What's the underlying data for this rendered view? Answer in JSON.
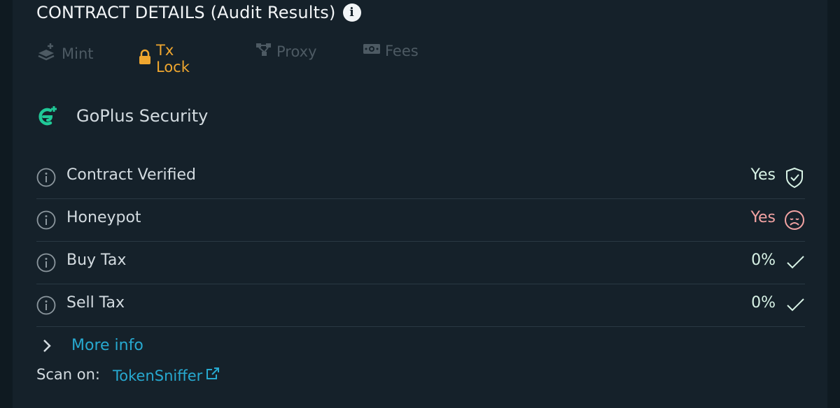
{
  "header": {
    "title": "CONTRACT DETAILS (Audit Results)",
    "info_icon": "info-circle-icon"
  },
  "tabs": [
    {
      "label": "Mint",
      "icon": "layers-plus-icon",
      "active": false
    },
    {
      "label": "Tx Lock",
      "icon": "lock-icon",
      "active": true
    },
    {
      "label": "Proxy",
      "icon": "network-icon",
      "active": false
    },
    {
      "label": "Fees",
      "icon": "banknote-icon",
      "active": false
    }
  ],
  "provider": {
    "name": "GoPlus Security",
    "icon": "goplus-logo-icon"
  },
  "checks": [
    {
      "label": "Contract Verified",
      "value": "Yes",
      "status": "shield-check-icon",
      "good": true
    },
    {
      "label": "Honeypot",
      "value": "Yes",
      "status": "sad-face-icon",
      "good": false
    },
    {
      "label": "Buy Tax",
      "value": "0%",
      "status": "check-icon",
      "good": true
    },
    {
      "label": "Sell Tax",
      "value": "0%",
      "status": "check-icon",
      "good": true
    }
  ],
  "more_info": {
    "label": "More info"
  },
  "scan": {
    "prefix": "Scan on:",
    "link_label": "TokenSniffer",
    "icon": "external-link-icon"
  },
  "colors": {
    "background": "#15212a",
    "accent_active_tab": "#f0a72f",
    "link": "#27a9d0",
    "good": "#d8f3e6",
    "bad": "#f3a3a3",
    "brand_green": "#20c997"
  }
}
